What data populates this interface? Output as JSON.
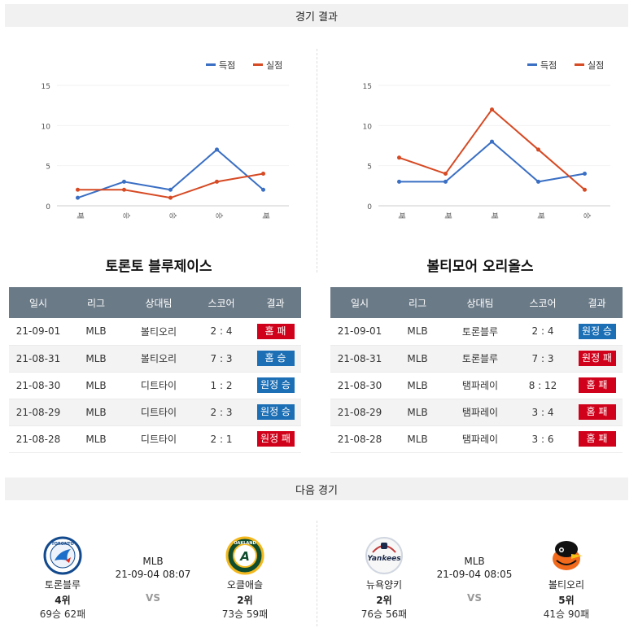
{
  "sections": {
    "results_title": "경기 결과",
    "next_title": "다음 경기"
  },
  "colors": {
    "scored": "#3a6fc4",
    "allowed": "#d64a24",
    "loss_badge": "#d0021b",
    "win_badge": "#1c6fb5"
  },
  "chart_data": [
    {
      "type": "line",
      "categories": [
        "패",
        "승",
        "승",
        "승",
        "패"
      ],
      "ylim": [
        0,
        15
      ],
      "yticks": [
        0,
        5,
        10,
        15
      ],
      "legend_position": "top-right",
      "series": [
        {
          "name": "득점",
          "values": [
            1,
            3,
            2,
            7,
            2
          ]
        },
        {
          "name": "실점",
          "values": [
            2,
            2,
            1,
            3,
            4
          ]
        }
      ]
    },
    {
      "type": "line",
      "categories": [
        "패",
        "패",
        "패",
        "패",
        "승"
      ],
      "ylim": [
        0,
        15
      ],
      "yticks": [
        0,
        5,
        10,
        15
      ],
      "legend_position": "top-right",
      "series": [
        {
          "name": "득점",
          "values": [
            3,
            3,
            8,
            3,
            4
          ]
        },
        {
          "name": "실점",
          "values": [
            6,
            4,
            12,
            7,
            2
          ]
        }
      ]
    }
  ],
  "columns": [
    "일시",
    "리그",
    "상대팀",
    "스코어",
    "결과"
  ],
  "left_team": {
    "title": "토론토 블루제이스",
    "rows": [
      {
        "date": "21-09-01",
        "league": "MLB",
        "opponent": "볼티오리",
        "score": "2 : 4",
        "result": "홈 패"
      },
      {
        "date": "21-08-31",
        "league": "MLB",
        "opponent": "볼티오리",
        "score": "7 : 3",
        "result": "홈 승"
      },
      {
        "date": "21-08-30",
        "league": "MLB",
        "opponent": "디트타이",
        "score": "1 : 2",
        "result": "원정 승"
      },
      {
        "date": "21-08-29",
        "league": "MLB",
        "opponent": "디트타이",
        "score": "2 : 3",
        "result": "원정 승"
      },
      {
        "date": "21-08-28",
        "league": "MLB",
        "opponent": "디트타이",
        "score": "2 : 1",
        "result": "원정 패"
      }
    ]
  },
  "right_team": {
    "title": "볼티모어 오리올스",
    "rows": [
      {
        "date": "21-09-01",
        "league": "MLB",
        "opponent": "토론블루",
        "score": "2 : 4",
        "result": "원정 승"
      },
      {
        "date": "21-08-31",
        "league": "MLB",
        "opponent": "토론블루",
        "score": "7 : 3",
        "result": "원정 패"
      },
      {
        "date": "21-08-30",
        "league": "MLB",
        "opponent": "탬파레이",
        "score": "8 : 12",
        "result": "홈 패"
      },
      {
        "date": "21-08-29",
        "league": "MLB",
        "opponent": "탬파레이",
        "score": "3 : 4",
        "result": "홈 패"
      },
      {
        "date": "21-08-28",
        "league": "MLB",
        "opponent": "탬파레이",
        "score": "3 : 6",
        "result": "홈 패"
      }
    ]
  },
  "next_games": [
    {
      "league": "MLB",
      "datetime": "21-09-04 08:07",
      "vs": "VS",
      "home": {
        "name": "토론블루",
        "rank": "4위",
        "record": "69승 62패",
        "logo": "blue-jays-logo",
        "logo_text": "TORONTO"
      },
      "away": {
        "name": "오클애슬",
        "rank": "2위",
        "record": "73승 59패",
        "logo": "athletics-logo",
        "logo_text": "OAKLAND"
      }
    },
    {
      "league": "MLB",
      "datetime": "21-09-04 08:05",
      "vs": "VS",
      "home": {
        "name": "뉴욕양키",
        "rank": "2위",
        "record": "76승 56패",
        "logo": "yankees-logo",
        "logo_text": "Yankees"
      },
      "away": {
        "name": "볼티오리",
        "rank": "5위",
        "record": "41승 90패",
        "logo": "orioles-logo",
        "logo_text": ""
      }
    }
  ]
}
